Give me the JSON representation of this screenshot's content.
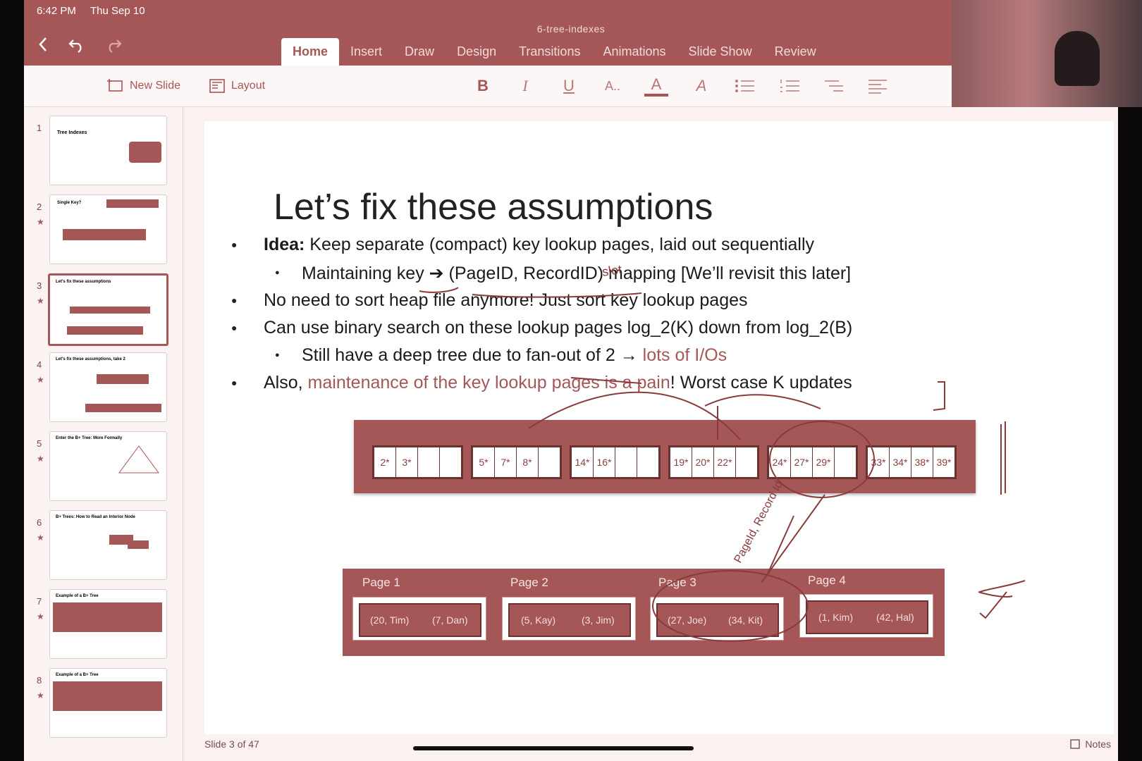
{
  "status": {
    "time": "6:42 PM",
    "date": "Thu Sep 10"
  },
  "doc_title": "6-tree-indexes",
  "tabs": [
    {
      "label": "Home",
      "active": true
    },
    {
      "label": "Insert"
    },
    {
      "label": "Draw"
    },
    {
      "label": "Design"
    },
    {
      "label": "Transitions"
    },
    {
      "label": "Animations"
    },
    {
      "label": "Slide Show"
    },
    {
      "label": "Review"
    }
  ],
  "toolbar": {
    "new_slide": "New Slide",
    "layout": "Layout"
  },
  "format": {
    "bold": "B",
    "italic": "I",
    "underline": "U",
    "font_size": "A..",
    "font_color": "A",
    "highlight": "A"
  },
  "thumbnails": [
    {
      "num": "1",
      "title": "Tree Indexes"
    },
    {
      "num": "2",
      "title": "Single Key?"
    },
    {
      "num": "3",
      "title": "Let's fix these assumptions"
    },
    {
      "num": "4",
      "title": "Let's fix these assumptions, take 2"
    },
    {
      "num": "5",
      "title": "Enter the B+ Tree: More Formally"
    },
    {
      "num": "6",
      "title": "B+ Trees: How to Read an Interior Node"
    },
    {
      "num": "7",
      "title": "Example of a B+ Tree"
    },
    {
      "num": "8",
      "title": "Example of a B+ Tree"
    }
  ],
  "slide": {
    "title": "Let’s fix these assumptions",
    "b1_bold": "Idea:",
    "b1_rest": " Keep separate (compact) key lookup pages, laid out sequentially",
    "b1a": "Maintaining key ➔ (PageID, RecordID) mapping [We’ll revisit this later]",
    "b2": "No need to sort heap file anymore! Just sort key lookup pages",
    "b3": "Can use binary search on these lookup pages log_2(K) down from log_2(B)",
    "b3a_pre": "Still have a deep tree due to fan-out of 2 → ",
    "b3a_hl": "lots of I/Os",
    "b4_pre": "Also, ",
    "b4_hl": "maintenance of the key lookup pages is a pain",
    "b4_post": "! Worst case K updates",
    "leaves": [
      [
        "2*",
        "3*",
        "",
        ""
      ],
      [
        "5*",
        "7*",
        "8*",
        ""
      ],
      [
        "14*",
        "16*",
        "",
        ""
      ],
      [
        "19*",
        "20*",
        "22*",
        ""
      ],
      [
        "24*",
        "27*",
        "29*",
        ""
      ],
      [
        "33*",
        "34*",
        "38*",
        "39*"
      ]
    ],
    "pages": [
      {
        "label": "Page 1",
        "r1": "(20, Tim)",
        "r2": "(7, Dan)"
      },
      {
        "label": "Page 2",
        "r1": "(5, Kay)",
        "r2": "(3, Jim)"
      },
      {
        "label": "Page 3",
        "r1": "(27, Joe)",
        "r2": "(34, Kit)"
      },
      {
        "label": "Page 4",
        "r1": "(1, Kim)",
        "r2": "(42, Hal)"
      }
    ],
    "ink_slot": "slot",
    "ink_pointer": "PageId, Record Id"
  },
  "footer": {
    "slide_num": "Slide 3 of 47",
    "notes": "Notes"
  },
  "colors": {
    "accent": "#a55757",
    "dark": "#6b3030"
  }
}
